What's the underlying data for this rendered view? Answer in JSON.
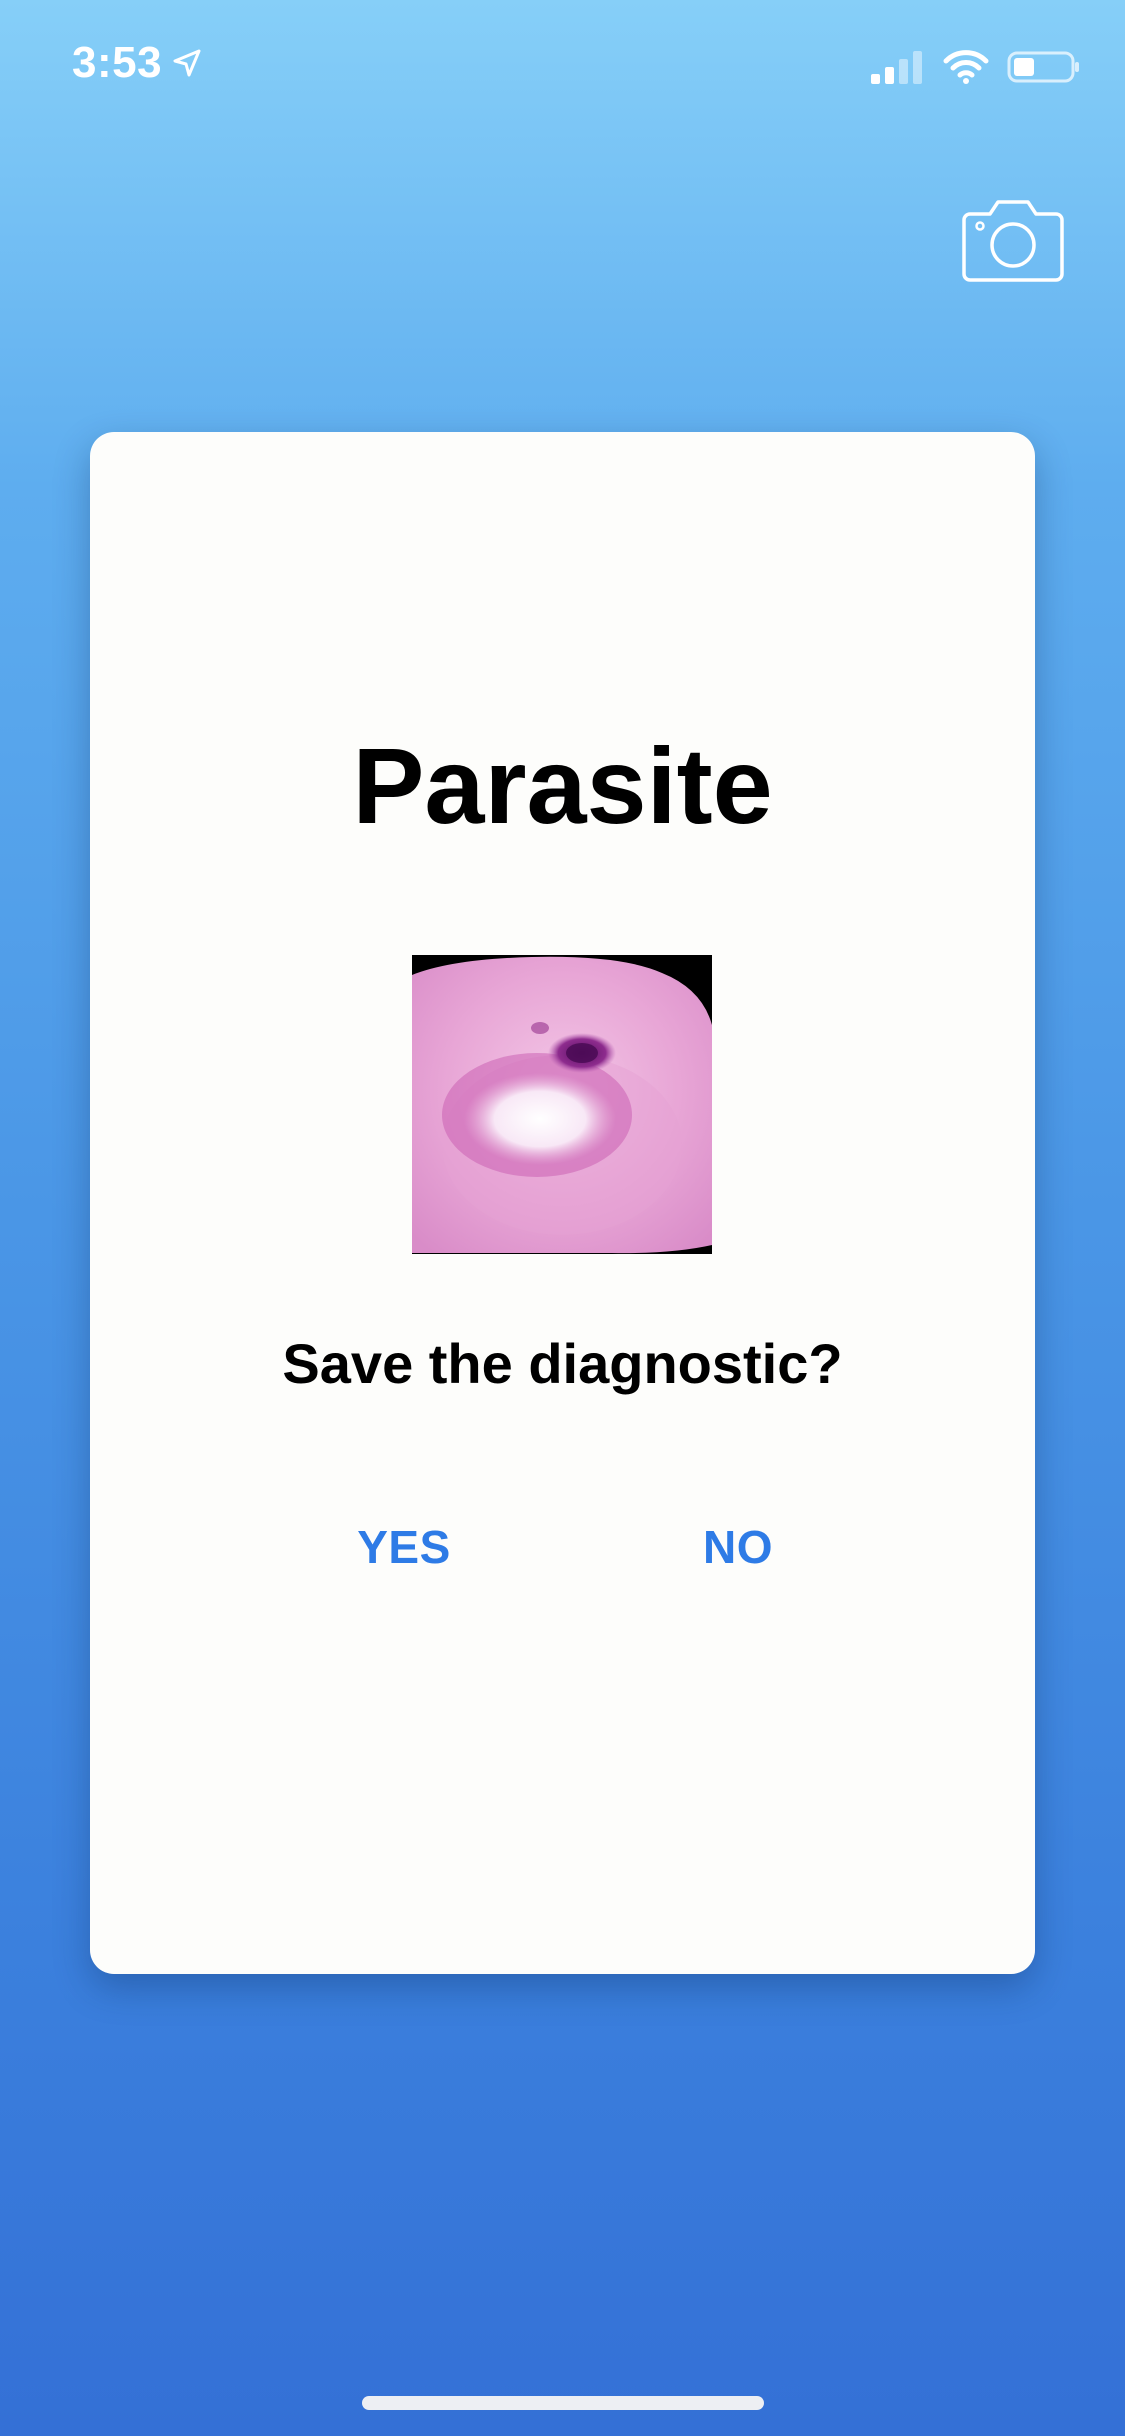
{
  "status_bar": {
    "time": "3:53",
    "icons": [
      "location-arrow-icon",
      "cellular-signal-icon",
      "wifi-icon",
      "battery-icon"
    ]
  },
  "toolbar": {
    "camera_icon": "camera-icon"
  },
  "dialog": {
    "title": "Parasite",
    "prompt": "Save the diagnostic?",
    "yes_label": "YES",
    "no_label": "NO"
  },
  "colors": {
    "accent": "#2E7BE6",
    "background_top": "#86CFF8",
    "background_bottom": "#3470D6",
    "card": "#FDFDFB"
  }
}
